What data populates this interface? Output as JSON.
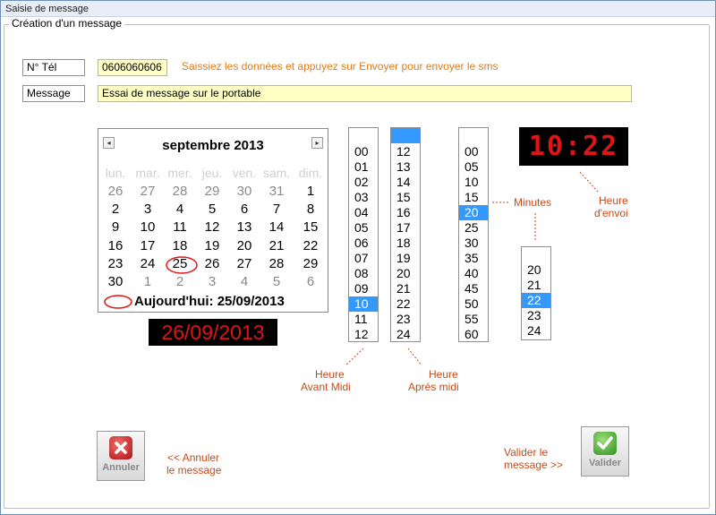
{
  "window": {
    "title": "Saisie de message"
  },
  "group": {
    "label": "Création d'un message"
  },
  "form": {
    "phone_label": "N° Tél",
    "phone_value": "0606060606",
    "hint": "Saissiez les données et appuyez sur Envoyer pour envoyer le sms",
    "message_label": "Message",
    "message_value": "Essai de message sur le portable"
  },
  "calendar": {
    "month_title": "septembre 2013",
    "prev": "◂",
    "next": "▸",
    "weekdays": [
      "lun.",
      "mar.",
      "mer.",
      "jeu.",
      "ven.",
      "sam.",
      "dim."
    ],
    "weeks": [
      [
        "26",
        "27",
        "28",
        "29",
        "30",
        "31",
        "1"
      ],
      [
        "2",
        "3",
        "4",
        "5",
        "6",
        "7",
        "8"
      ],
      [
        "9",
        "10",
        "11",
        "12",
        "13",
        "14",
        "15"
      ],
      [
        "16",
        "17",
        "18",
        "19",
        "20",
        "21",
        "22"
      ],
      [
        "23",
        "24",
        "25",
        "26",
        "27",
        "28",
        "29"
      ],
      [
        "30",
        "1",
        "2",
        "3",
        "4",
        "5",
        "6"
      ]
    ],
    "today_text": "Aujourd'hui: 25/09/2013"
  },
  "selected_date": "26/09/2013",
  "send_time": "10:22",
  "hours_am": {
    "items": [
      "00",
      "01",
      "02",
      "03",
      "04",
      "05",
      "06",
      "07",
      "08",
      "09",
      "10",
      "11",
      "12"
    ],
    "selected": "10"
  },
  "hours_pm": {
    "items": [
      "12",
      "13",
      "14",
      "15",
      "16",
      "17",
      "18",
      "19",
      "20",
      "21",
      "22",
      "23",
      "24"
    ]
  },
  "minutes": {
    "items": [
      "00",
      "05",
      "10",
      "15",
      "20",
      "25",
      "30",
      "35",
      "40",
      "45",
      "50",
      "55",
      "60"
    ],
    "selected": "20"
  },
  "minutes_fine": {
    "items": [
      "20",
      "21",
      "22",
      "23",
      "24"
    ],
    "selected": "22"
  },
  "annotations": {
    "minutes": "Minutes",
    "heure_envoi_1": "Heure",
    "heure_envoi_2": "d'envoi",
    "am_1": "Heure",
    "am_2": "Avant Midi",
    "pm_1": "Heure",
    "pm_2": "Aprés midi",
    "cancel_1": "<<  Annuler",
    "cancel_2": "le message",
    "validate_1": "Valider le",
    "validate_2": "message >>"
  },
  "buttons": {
    "cancel": "Annuler",
    "validate": "Valider"
  }
}
